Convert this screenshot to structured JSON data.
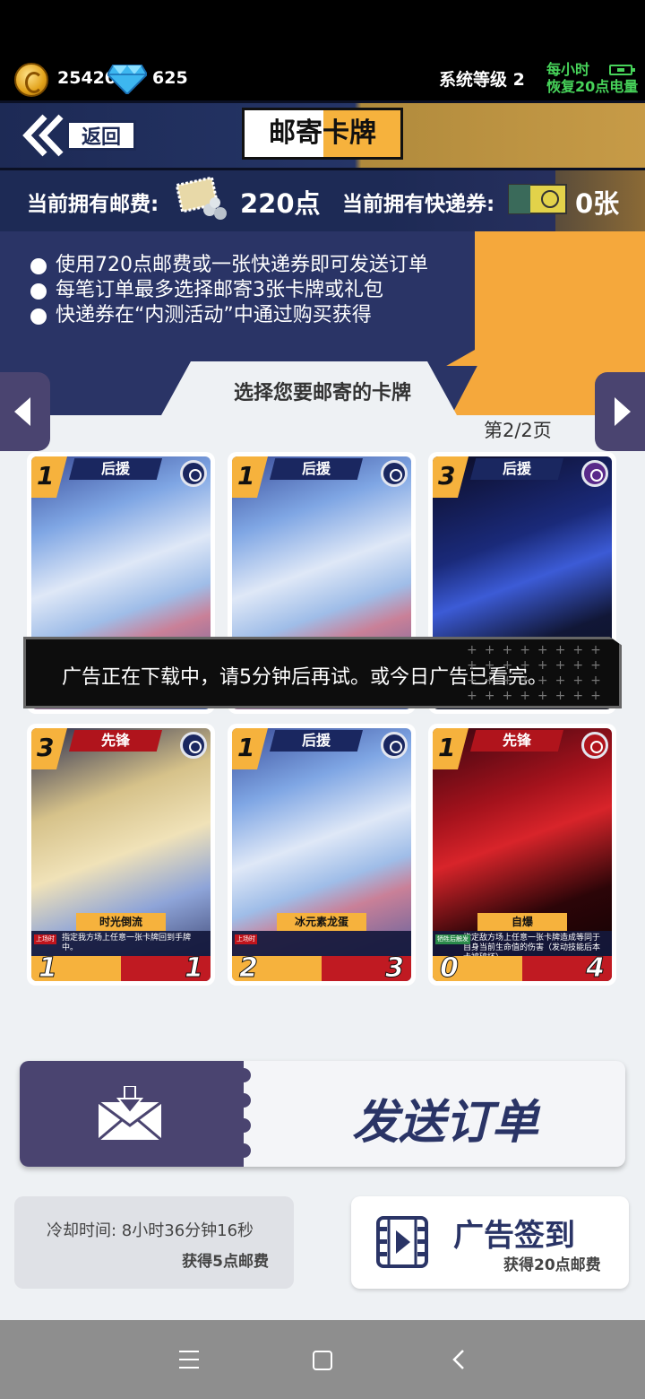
{
  "resources": {
    "coins": "25420",
    "diamonds": "625",
    "system_level": "系统等级 2",
    "energy_line1": "每小时",
    "energy_line2": "恢复20点电量"
  },
  "header": {
    "back_label": "返回",
    "title": "邮寄卡牌"
  },
  "postage": {
    "postage_label": "当前拥有邮费:",
    "postage_value": "220点",
    "express_label": "当前拥有快递券:",
    "express_value": "0张"
  },
  "info": {
    "rules": [
      "使用720点邮费或一张快递券即可发送订单",
      "每笔订单最多选择邮寄3张卡牌或礼包",
      "快递券在“内测活动”中通过购买获得"
    ]
  },
  "selection": {
    "title": "选择您要邮寄的卡牌",
    "page": "第2/2页"
  },
  "cards": [
    {
      "cost": "1",
      "type": "后援",
      "name": "",
      "desc": "",
      "atk": "",
      "hp": ""
    },
    {
      "cost": "1",
      "type": "后援",
      "name": "",
      "desc": "",
      "atk": "",
      "hp": ""
    },
    {
      "cost": "3",
      "type": "后援",
      "name": "",
      "desc": "",
      "atk": "",
      "hp": ""
    },
    {
      "cost": "3",
      "type": "先锋",
      "name": "时光倒流",
      "tag": "上场时",
      "desc": "指定我方场上任意一张卡牌回到手牌中。",
      "atk": "1",
      "hp": "1"
    },
    {
      "cost": "1",
      "type": "后援",
      "name": "冰元素龙蛋",
      "tag": "上场时",
      "desc": "",
      "atk": "2",
      "hp": "3"
    },
    {
      "cost": "1",
      "type": "先锋",
      "name": "自爆",
      "tag": "牺牲后触发",
      "desc": "指定敌方场上任意一张卡牌造成等同于自身当前生命值的伤害（发动技能后本卡被破坏）。",
      "atk": "0",
      "hp": "4"
    }
  ],
  "toast": {
    "message": "广告正在下载中，请5分钟后再试。或今日广告已看完。"
  },
  "actions": {
    "send_label": "发送订单",
    "cooldown_text": "冷却时间: 8小时36分钟16秒",
    "cooldown_reward": "获得5点邮费",
    "ad_title": "广告签到",
    "ad_reward": "获得20点邮费"
  },
  "colors": {
    "navy": "#2a3466",
    "gold": "#f6b23d",
    "purple_btn": "#4a4470"
  }
}
